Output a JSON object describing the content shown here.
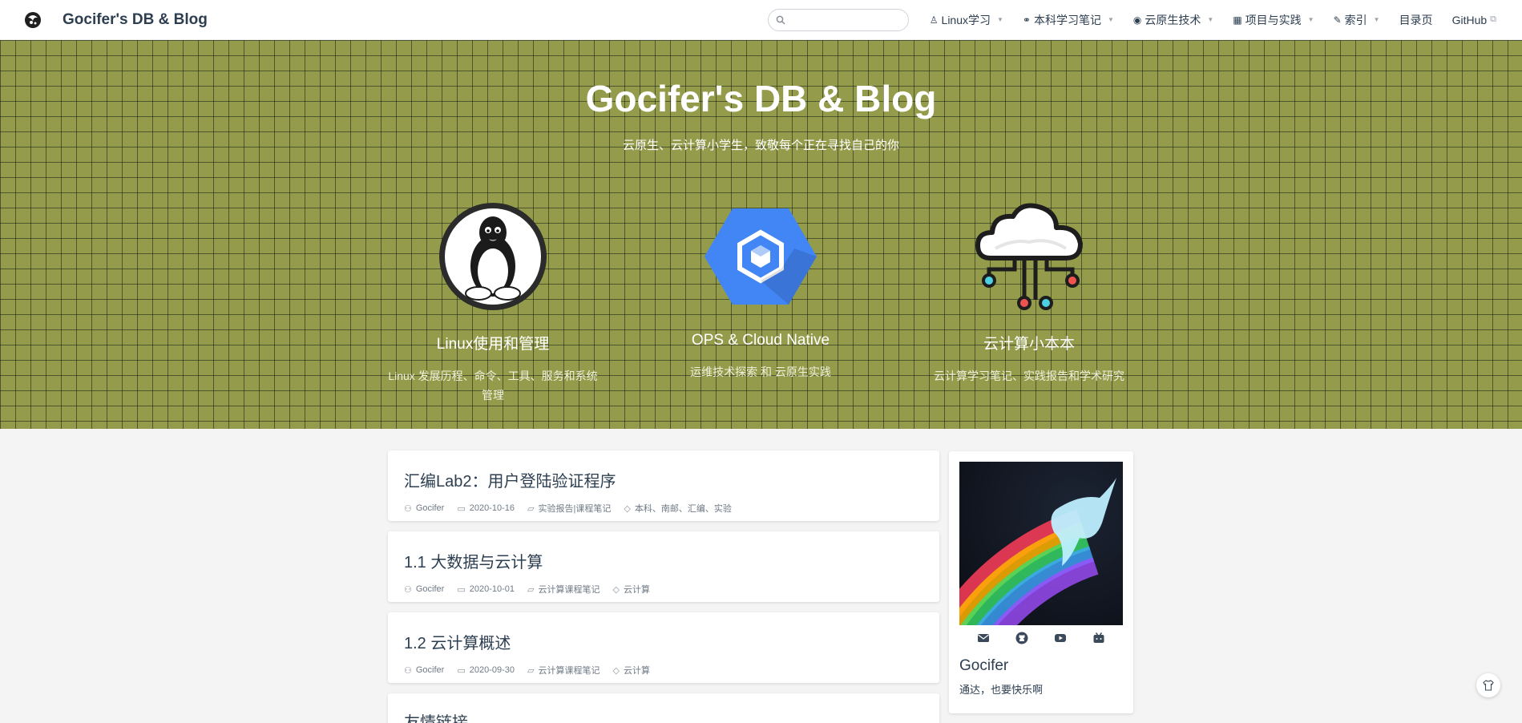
{
  "navbar": {
    "site_name": "Gocifer's DB & Blog",
    "search_placeholder": "",
    "items": [
      {
        "label": "Linux学习",
        "icon": "tux-icon",
        "dropdown": true
      },
      {
        "label": "本科学习笔记",
        "icon": "link-icon",
        "dropdown": true
      },
      {
        "label": "云原生技术",
        "icon": "globe-icon",
        "dropdown": true
      },
      {
        "label": "项目与实践",
        "icon": "grid-icon",
        "dropdown": true
      },
      {
        "label": "索引",
        "icon": "pen-icon",
        "dropdown": true
      },
      {
        "label": "目录页",
        "icon": "",
        "dropdown": false
      },
      {
        "label": "GitHub",
        "icon": "external-link-icon",
        "dropdown": false
      }
    ]
  },
  "hero": {
    "title": "Gocifer's DB & Blog",
    "subtitle": "云原生、云计算小学生，致敬每个正在寻找自己的你",
    "background_color": "#949c4b",
    "features": [
      {
        "title": "Linux使用和管理",
        "desc": "Linux 发展历程、命令、工具、服务和系统管理",
        "icon": "tux-penguin-icon"
      },
      {
        "title": "OPS & Cloud Native",
        "desc": "运维技术探索 和 云原生实践",
        "icon": "cloud-build-hexagon-icon"
      },
      {
        "title": "云计算小本本",
        "desc": "云计算学习笔记、实践报告和学术研究",
        "icon": "cloud-network-icon"
      }
    ]
  },
  "posts": [
    {
      "title": "汇编Lab2：用户登陆验证程序",
      "author": "Gocifer",
      "date": "2020-10-16",
      "category": "实验报告|课程笔记",
      "tags": "本科、南邮、汇编、实验"
    },
    {
      "title": "1.1 大数据与云计算",
      "author": "Gocifer",
      "date": "2020-10-01",
      "category": "云计算课程笔记",
      "tags": "云计算"
    },
    {
      "title": "1.2 云计算概述",
      "author": "Gocifer",
      "date": "2020-09-30",
      "category": "云计算课程笔记",
      "tags": "云计算"
    },
    {
      "title": "友情链接",
      "author": "",
      "date": "",
      "category": "",
      "tags": ""
    }
  ],
  "profile": {
    "name": "Gocifer",
    "motto": "通达，也要快乐啊",
    "socials": [
      "mail-icon",
      "github-icon",
      "youtube-icon",
      "bilibili-icon"
    ]
  },
  "colors": {
    "accent": "#2c3e50",
    "hero_bg": "#949c4b"
  }
}
